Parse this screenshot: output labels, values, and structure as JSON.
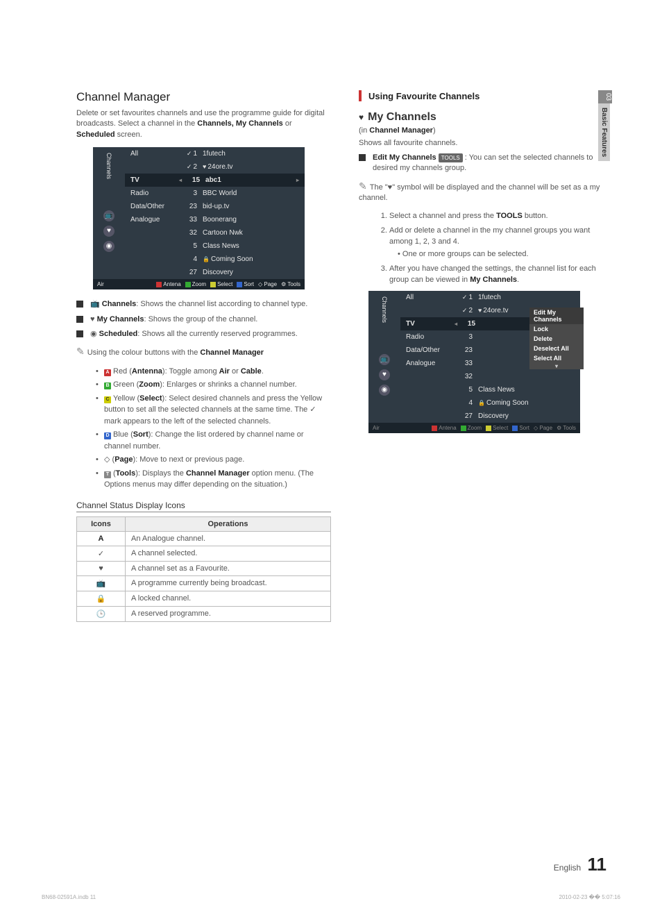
{
  "left": {
    "title": "Channel Manager",
    "desc_1": "Delete or set favourites channels and use the programme guide for digital broadcasts. Select a channel in the ",
    "desc_2_bold": "Channels, My Channels",
    "desc_3": " or ",
    "desc_4_bold": "Scheduled",
    "desc_5": " screen.",
    "scr": {
      "side_label": "Channels",
      "all": "All",
      "tv": "TV",
      "radio": "Radio",
      "data": "Data/Other",
      "analogue": "Analogue",
      "c1n": "1",
      "c1": "1futech",
      "c2n": "2",
      "c2": "24ore.tv",
      "c3n": "15",
      "c3": "abc1",
      "r1n": "3",
      "r1": "BBC World",
      "r2n": "23",
      "r2": "bid-up.tv",
      "r3n": "33",
      "r3": "Boonerang",
      "r4n": "32",
      "r4": "Cartoon Nwk",
      "r5n": "5",
      "r5": "Class News",
      "r6n": "4",
      "r6": "Coming Soon",
      "r7n": "27",
      "r7": "Discovery",
      "foot_air": "Air",
      "f1": "Antena",
      "f2": "Zoom",
      "f3": "Select",
      "f4": "Sort",
      "f5": "Page",
      "f6": "Tools"
    },
    "b1a": "Channels",
    "b1b": ": Shows the channel list according to channel type.",
    "b2a": "My Channels",
    "b2b": ": Shows the group of the channel.",
    "b3a": "Scheduled",
    "b3b": ": Shows all the currently reserved programmes.",
    "note_lead": "Using the colour buttons with the ",
    "note_bold": "Channel Manager",
    "d1a": "Red (",
    "d1b": "Antenna",
    "d1c": "): Toggle among ",
    "d1d": "Air",
    "d1e": " or ",
    "d1f": "Cable",
    "d1g": ".",
    "d2a": "Green (",
    "d2b": "Zoom",
    "d2c": "): Enlarges or shrinks a channel number.",
    "d3a": "Yellow (",
    "d3b": "Select",
    "d3c": "): Select desired channels and press the Yellow button to set all the selected channels at the same time. The ✓ mark appears to the left of the selected channels.",
    "d4a": "Blue (",
    "d4b": "Sort",
    "d4c": "): Change the list ordered by channel name or channel number.",
    "d5a": "(",
    "d5b": "Page",
    "d5c": "): Move to next or previous page.",
    "d6a": "(",
    "d6b": "Tools",
    "d6c": "): Displays the ",
    "d6d": "Channel Manager",
    "d6e": " option menu. (The Options menus may differ depending on the situation.)",
    "tbl_title": "Channel Status Display Icons",
    "th1": "Icons",
    "th2": "Operations",
    "t1i": "A",
    "t1": "An Analogue channel.",
    "t2i": "✓",
    "t2": "A channel selected.",
    "t3i": "♥",
    "t3": "A channel set as a Favourite.",
    "t4i": "📺",
    "t4": "A programme currently being broadcast.",
    "t5i": "🔒",
    "t5": "A locked channel.",
    "t6i": "🕒",
    "t6": "A reserved programme."
  },
  "right": {
    "hdr": "Using Favourite Channels",
    "sect": "My Channels",
    "sub1": "(in ",
    "sub1b": "Channel Manager",
    "sub1c": ")",
    "sub2": "Shows all favourite channels.",
    "e1a": "Edit My Channels",
    "tools_badge": "TOOLS",
    "e1b": " : You can set the selected channels to desired my channels group.",
    "note1a": "The \"",
    "note1b": "♥",
    "note1c": "\" symbol will be displayed and the channel will be set as a my channel.",
    "s1a": "Select a channel and press the ",
    "s1b": "TOOLS",
    "s1c": " button.",
    "s2": "Add or delete a channel in the my channel groups you want among 1, 2, 3 and 4.",
    "s2s": "One or more groups can be selected.",
    "s3a": "After you have changed the settings, the channel list for each group can be viewed in ",
    "s3b": "My Channels",
    "s3c": ".",
    "menu": {
      "h": "Edit My Channels",
      "m1": "Lock",
      "m2": "Delete",
      "m3": "Deselect All",
      "m4": "Select All"
    }
  },
  "side": {
    "num": "03",
    "label": "Basic Features"
  },
  "footer": {
    "lang": "English",
    "page": "11"
  },
  "meta": {
    "left": "BN68-02591A.indb   11",
    "right": "2010-02-23   �� 5:07:16"
  }
}
